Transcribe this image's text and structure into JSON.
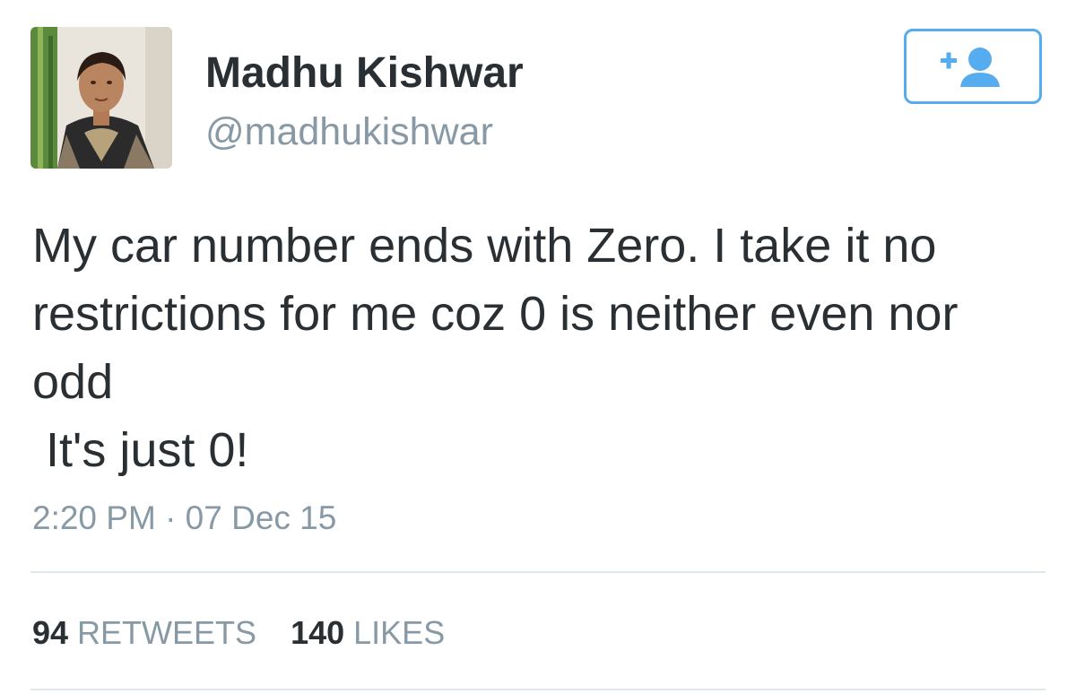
{
  "user": {
    "display_name": "Madhu Kishwar",
    "handle": "@madhukishwar",
    "avatar_icon": "profile-photo"
  },
  "follow_button": {
    "icon": "follow-user-icon",
    "color": "#55acee"
  },
  "tweet": {
    "lines": [
      "My car number ends with Zero. I take it no",
      "restrictions for me coz 0 is neither even nor",
      "odd",
      " It's just 0!"
    ],
    "timestamp": "2:20 PM · 07 Dec 15"
  },
  "stats": {
    "retweets_count": "94",
    "retweets_label": "RETWEETS",
    "likes_count": "140",
    "likes_label": "LIKES"
  },
  "colors": {
    "text": "#292f33",
    "secondary": "#8899a6",
    "accent": "#55acee",
    "divider": "#e1e8ed"
  }
}
